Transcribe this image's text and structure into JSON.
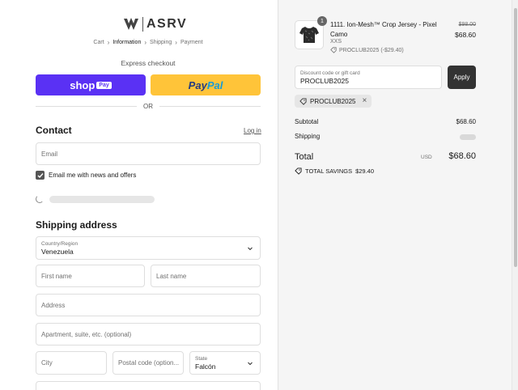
{
  "brand": {
    "name": "ASRV"
  },
  "breadcrumb": [
    {
      "label": "Cart"
    },
    {
      "label": "Information"
    },
    {
      "label": "Shipping"
    },
    {
      "label": "Payment"
    }
  ],
  "express": {
    "title": "Express checkout",
    "shop_label": "shop",
    "shop_pay_label": "Pay",
    "paypal_part1": "Pay",
    "paypal_part2": "Pal",
    "or_label": "OR"
  },
  "contact": {
    "heading": "Contact",
    "login_label": "Log in",
    "email_placeholder": "Email",
    "newsletter_label": "Email me with news and offers",
    "newsletter_checked": true
  },
  "shipping": {
    "heading": "Shipping address",
    "country_label": "Country/Region",
    "country_value": "Venezuela",
    "first_name_placeholder": "First name",
    "last_name_placeholder": "Last name",
    "address_placeholder": "Address",
    "apartment_placeholder": "Apartment, suite, etc. (optional)",
    "city_placeholder": "City",
    "postal_placeholder": "Postal code (option...",
    "state_label": "State",
    "state_value": "Falcón"
  },
  "order": {
    "quantity": "1",
    "product_name": "1111. Ion-Mesh™ Crop Jersey - Pixel Camo",
    "variant": "XXS",
    "item_discount": "PROCLUB2025 (-$29.40)",
    "price_original": "$98.00",
    "price_current": "$68.60"
  },
  "discount": {
    "label": "Discount code or gift card",
    "value": "PROCLUB2025",
    "apply_label": "Apply",
    "applied_code": "PROCLUB2025"
  },
  "summary": {
    "subtotal_label": "Subtotal",
    "subtotal_value": "$68.60",
    "shipping_label": "Shipping",
    "total_label": "Total",
    "currency": "USD",
    "total_value": "$68.60",
    "savings_label": "TOTAL SAVINGS",
    "savings_value": "$29.40"
  },
  "colors": {
    "shop_pay": "#5a31f4",
    "paypal": "#ffc439",
    "apply_button": "#333333",
    "summary_bg": "#f5f5f5"
  }
}
